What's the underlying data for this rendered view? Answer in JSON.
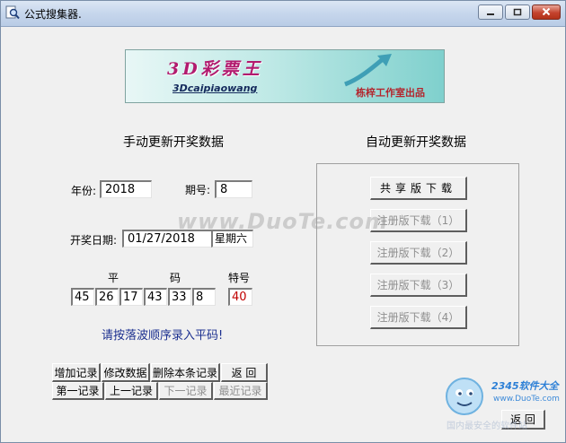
{
  "window": {
    "title": "公式搜集器.",
    "icon": "magnifier-app-icon",
    "controls": {
      "minimize_icon": "minimize-icon",
      "maximize_icon": "maximize-icon",
      "close_icon": "close-icon"
    }
  },
  "banner": {
    "title": "3D彩票王",
    "subtitle": "3Dcaipiaowang",
    "maker": "栋梓工作室出品"
  },
  "manual": {
    "heading": "手动更新开奖数据",
    "year_label": "年份:",
    "year_value": "2018",
    "issue_label": "期号:",
    "issue_value": "8",
    "date_label": "开奖日期:",
    "date_value": "01/27/2018",
    "weekday_value": "星期六",
    "ping_label": "平",
    "ma_label": "码",
    "special_label": "特号",
    "ping_numbers": [
      "45",
      "26",
      "17",
      "43",
      "33",
      "8"
    ],
    "special_number": "40",
    "hint": "请按落波顺序录入平码!"
  },
  "auto": {
    "heading": "自动更新开奖数据",
    "buttons": [
      "共享版下载",
      "注册版下载（1）",
      "注册版下载（2）",
      "注册版下载（3）",
      "注册版下载（4）"
    ]
  },
  "actions": {
    "row1": [
      "增加记录",
      "修改数据",
      "删除本条记录",
      "返 回"
    ],
    "row2": [
      "第一记录",
      "上一记录",
      "下一记录",
      "最近记录"
    ]
  },
  "footer": {
    "return_label": "返 回"
  },
  "watermarks": {
    "center": "www.DuoTe.com",
    "brand_line1": "2345软件大全",
    "brand_line2": "www.DuoTe.com",
    "brand_line3": "国内最安全的软件站"
  },
  "colors": {
    "accent_magenta": "#b21a6e",
    "hint_blue": "#1b2f8f",
    "special_red": "#c00000",
    "disabled_gray": "#8f8f8f"
  }
}
